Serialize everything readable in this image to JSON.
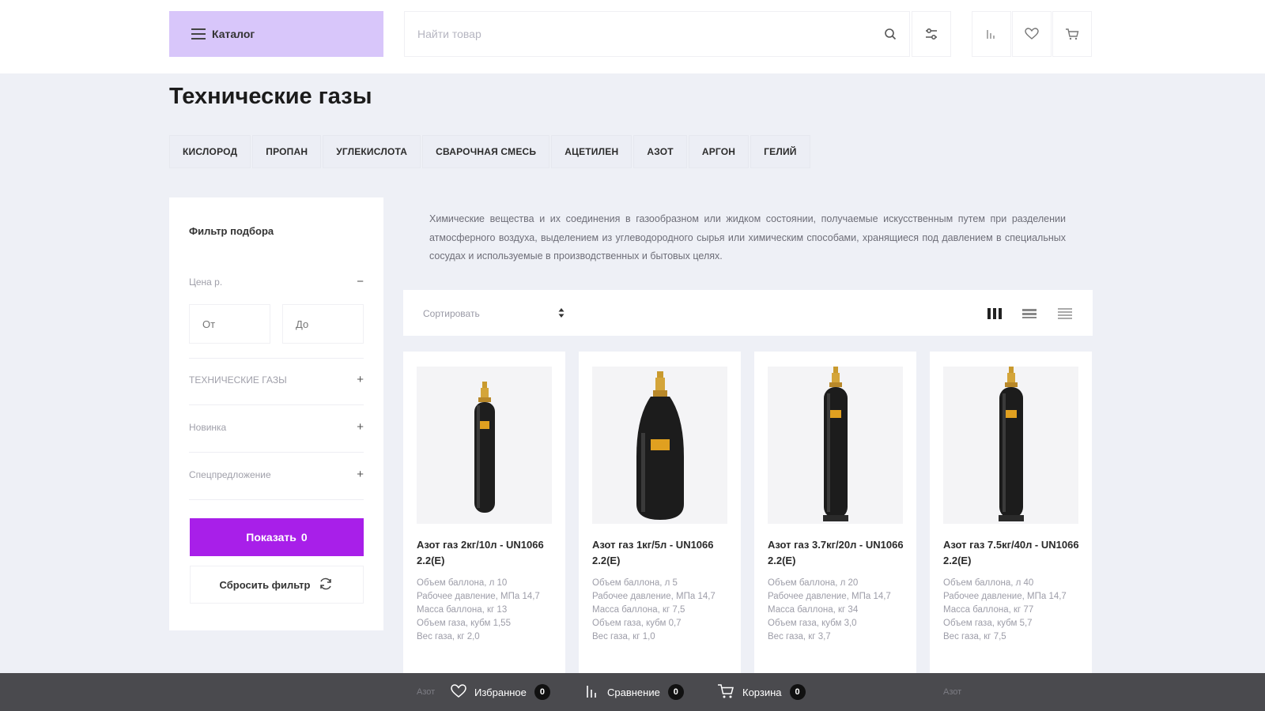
{
  "header": {
    "catalog_label": "Каталог",
    "search_placeholder": "Найти товар"
  },
  "page": {
    "title": "Технические газы",
    "tags": [
      "КИСЛОРОД",
      "ПРОПАН",
      "УГЛЕКИСЛОТА",
      "СВАРОЧНАЯ СМЕСЬ",
      "АЦЕТИЛЕН",
      "АЗОТ",
      "АРГОН",
      "ГЕЛИЙ"
    ],
    "description": "Химические вещества и их соединения в газообразном или жидком состоянии, получаемые искусственным путем при разделении атмосферного воздуха, выделением из углеводородного сырья или химическим способами, хранящиеся под давлением в специальных сосудах и используемые в производственных и бытовых целях."
  },
  "filter": {
    "title": "Фильтр подбора",
    "price_label": "Цена р.",
    "price_toggle": "−",
    "from_placeholder": "От",
    "to_placeholder": "До",
    "sections": [
      {
        "label": "ТЕХНИЧЕСКИЕ ГАЗЫ",
        "toggle": "+"
      },
      {
        "label": "Новинка",
        "toggle": "+"
      },
      {
        "label": "Спецпредложение",
        "toggle": "+"
      }
    ],
    "show_label": "Показать",
    "show_count": "0",
    "reset_label": "Сбросить фильтр"
  },
  "sort": {
    "label": "Сортировать"
  },
  "products": [
    {
      "name": "Азот газ 2кг/10л - UN1066 2.2(E)",
      "props": [
        "Объем баллона, л 10",
        "Рабочее давление, МПа 14,7",
        "Масса баллона, кг 13",
        "Объем газа, кубм 1,55",
        "Вес газа, кг 2,0"
      ],
      "shape": "slim"
    },
    {
      "name": "Азот газ 1кг/5л - UN1066 2.2(E)",
      "props": [
        "Объем баллона, л 5",
        "Рабочее давление, МПа 14,7",
        "Масса баллона, кг 7,5",
        "Объем газа, кубм 0,7",
        "Вес газа, кг 1,0"
      ],
      "shape": "fat"
    },
    {
      "name": "Азот газ 3.7кг/20л - UN1066 2.2(E)",
      "props": [
        "Объем баллона, л 20",
        "Рабочее давление, МПа 14,7",
        "Масса баллона, кг 34",
        "Объем газа, кубм 3,0",
        "Вес газа, кг 3,7"
      ],
      "shape": "tall"
    },
    {
      "name": "Азот газ 7.5кг/40л - UN1066 2.2(E)",
      "props": [
        "Объем баллона, л 40",
        "Рабочее давление, МПа 14,7",
        "Масса баллона, кг 77",
        "Объем газа, кубм 5,7",
        "Вес газа, кг 7,5"
      ],
      "shape": "tall"
    }
  ],
  "bottom_bar": {
    "favorites_label": "Избранное",
    "favorites_count": "0",
    "compare_label": "Сравнение",
    "compare_count": "0",
    "cart_label": "Корзина",
    "cart_count": "0",
    "ghost_text": "Азот"
  },
  "colors": {
    "accent": "#a81fe9",
    "catalog_bg": "#d8c6fa",
    "page_bg": "#eef0f6",
    "bottom_bar_bg": "#4a4a4e"
  }
}
